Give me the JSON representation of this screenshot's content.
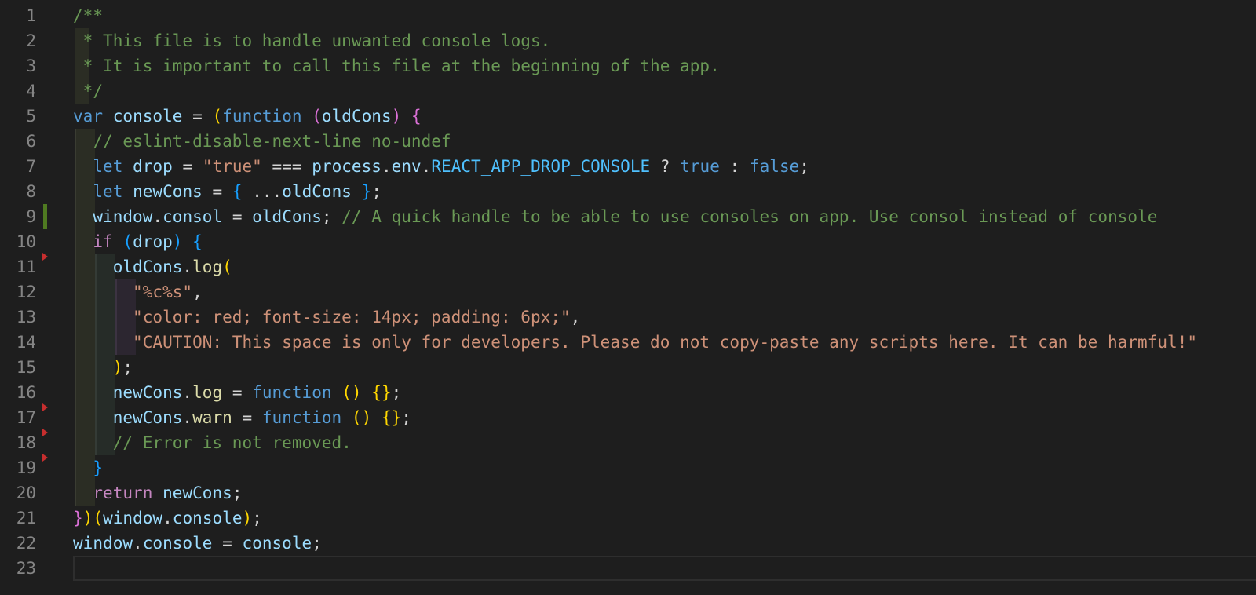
{
  "editor": {
    "language": "javascript",
    "modified_line": 9,
    "fold_markers_at_lines": [
      11,
      17,
      18,
      19
    ],
    "lines": [
      {
        "n": "1",
        "tokens": [
          {
            "t": "/**",
            "c": "cm"
          }
        ]
      },
      {
        "n": "2",
        "tokens": [
          {
            "t": " * This file is to handle unwanted console logs.",
            "c": "cm"
          }
        ]
      },
      {
        "n": "3",
        "tokens": [
          {
            "t": " * It is important to call this file at the beginning of the app.",
            "c": "cm"
          }
        ]
      },
      {
        "n": "4",
        "tokens": [
          {
            "t": " */",
            "c": "cm"
          }
        ]
      },
      {
        "n": "5",
        "tokens": [
          {
            "t": "var",
            "c": "kw"
          },
          {
            "t": " ",
            "c": "pl"
          },
          {
            "t": "console",
            "c": "vr"
          },
          {
            "t": " = ",
            "c": "pl"
          },
          {
            "t": "(",
            "c": "b1"
          },
          {
            "t": "function",
            "c": "kw"
          },
          {
            "t": " ",
            "c": "pl"
          },
          {
            "t": "(",
            "c": "b2"
          },
          {
            "t": "oldCons",
            "c": "vr"
          },
          {
            "t": ")",
            "c": "b2"
          },
          {
            "t": " ",
            "c": "pl"
          },
          {
            "t": "{",
            "c": "b2"
          }
        ]
      },
      {
        "n": "6",
        "tokens": [
          {
            "t": "  ",
            "c": "pl"
          },
          {
            "t": "// eslint-disable-next-line no-undef",
            "c": "cm"
          }
        ]
      },
      {
        "n": "7",
        "tokens": [
          {
            "t": "  ",
            "c": "pl"
          },
          {
            "t": "let",
            "c": "kw"
          },
          {
            "t": " ",
            "c": "pl"
          },
          {
            "t": "drop",
            "c": "vr"
          },
          {
            "t": " = ",
            "c": "pl"
          },
          {
            "t": "\"true\"",
            "c": "st"
          },
          {
            "t": " === ",
            "c": "pl"
          },
          {
            "t": "process",
            "c": "vr"
          },
          {
            "t": ".",
            "c": "pl"
          },
          {
            "t": "env",
            "c": "vr"
          },
          {
            "t": ".",
            "c": "pl"
          },
          {
            "t": "REACT_APP_DROP_CONSOLE",
            "c": "cn"
          },
          {
            "t": " ? ",
            "c": "pl"
          },
          {
            "t": "true",
            "c": "kw"
          },
          {
            "t": " : ",
            "c": "pl"
          },
          {
            "t": "false",
            "c": "kw"
          },
          {
            "t": ";",
            "c": "pl"
          }
        ]
      },
      {
        "n": "8",
        "tokens": [
          {
            "t": "  ",
            "c": "pl"
          },
          {
            "t": "let",
            "c": "kw"
          },
          {
            "t": " ",
            "c": "pl"
          },
          {
            "t": "newCons",
            "c": "vr"
          },
          {
            "t": " = ",
            "c": "pl"
          },
          {
            "t": "{",
            "c": "b3"
          },
          {
            "t": " ...",
            "c": "pl"
          },
          {
            "t": "oldCons",
            "c": "vr"
          },
          {
            "t": " ",
            "c": "pl"
          },
          {
            "t": "}",
            "c": "b3"
          },
          {
            "t": ";",
            "c": "pl"
          }
        ]
      },
      {
        "n": "9",
        "tokens": [
          {
            "t": "  ",
            "c": "pl"
          },
          {
            "t": "window",
            "c": "vr"
          },
          {
            "t": ".",
            "c": "pl"
          },
          {
            "t": "consol",
            "c": "vr"
          },
          {
            "t": " = ",
            "c": "pl"
          },
          {
            "t": "oldCons",
            "c": "vr"
          },
          {
            "t": "; ",
            "c": "pl"
          },
          {
            "t": "// A quick handle to be able to use consoles on app. Use consol instead of console",
            "c": "cm"
          }
        ]
      },
      {
        "n": "10",
        "tokens": [
          {
            "t": "  ",
            "c": "pl"
          },
          {
            "t": "if",
            "c": "ctl"
          },
          {
            "t": " ",
            "c": "pl"
          },
          {
            "t": "(",
            "c": "b3"
          },
          {
            "t": "drop",
            "c": "vr"
          },
          {
            "t": ")",
            "c": "b3"
          },
          {
            "t": " ",
            "c": "pl"
          },
          {
            "t": "{",
            "c": "b3"
          }
        ]
      },
      {
        "n": "11",
        "tokens": [
          {
            "t": "    ",
            "c": "pl"
          },
          {
            "t": "oldCons",
            "c": "vr"
          },
          {
            "t": ".",
            "c": "pl"
          },
          {
            "t": "log",
            "c": "fn"
          },
          {
            "t": "(",
            "c": "b1"
          }
        ]
      },
      {
        "n": "12",
        "tokens": [
          {
            "t": "      ",
            "c": "pl"
          },
          {
            "t": "\"%c%s\"",
            "c": "st"
          },
          {
            "t": ",",
            "c": "pl"
          }
        ]
      },
      {
        "n": "13",
        "tokens": [
          {
            "t": "      ",
            "c": "pl"
          },
          {
            "t": "\"color: red; font-size: 14px; padding: 6px;\"",
            "c": "st"
          },
          {
            "t": ",",
            "c": "pl"
          }
        ]
      },
      {
        "n": "14",
        "tokens": [
          {
            "t": "      ",
            "c": "pl"
          },
          {
            "t": "\"CAUTION: This space is only for developers. Please do not copy-paste any scripts here. It can be harmful!\"",
            "c": "st"
          }
        ]
      },
      {
        "n": "15",
        "tokens": [
          {
            "t": "    ",
            "c": "pl"
          },
          {
            "t": ")",
            "c": "b1"
          },
          {
            "t": ";",
            "c": "pl"
          }
        ]
      },
      {
        "n": "16",
        "tokens": [
          {
            "t": "    ",
            "c": "pl"
          },
          {
            "t": "newCons",
            "c": "vr"
          },
          {
            "t": ".",
            "c": "pl"
          },
          {
            "t": "log",
            "c": "fn"
          },
          {
            "t": " = ",
            "c": "pl"
          },
          {
            "t": "function",
            "c": "kw"
          },
          {
            "t": " ",
            "c": "pl"
          },
          {
            "t": "()",
            "c": "b1"
          },
          {
            "t": " ",
            "c": "pl"
          },
          {
            "t": "{}",
            "c": "b1"
          },
          {
            "t": ";",
            "c": "pl"
          }
        ]
      },
      {
        "n": "17",
        "tokens": [
          {
            "t": "    ",
            "c": "pl"
          },
          {
            "t": "newCons",
            "c": "vr"
          },
          {
            "t": ".",
            "c": "pl"
          },
          {
            "t": "warn",
            "c": "fn"
          },
          {
            "t": " = ",
            "c": "pl"
          },
          {
            "t": "function",
            "c": "kw"
          },
          {
            "t": " ",
            "c": "pl"
          },
          {
            "t": "()",
            "c": "b1"
          },
          {
            "t": " ",
            "c": "pl"
          },
          {
            "t": "{}",
            "c": "b1"
          },
          {
            "t": ";",
            "c": "pl"
          }
        ]
      },
      {
        "n": "18",
        "tokens": [
          {
            "t": "    ",
            "c": "pl"
          },
          {
            "t": "// Error is not removed.",
            "c": "cm"
          }
        ]
      },
      {
        "n": "19",
        "tokens": [
          {
            "t": "  ",
            "c": "pl"
          },
          {
            "t": "}",
            "c": "b3"
          }
        ]
      },
      {
        "n": "20",
        "tokens": [
          {
            "t": "  ",
            "c": "pl"
          },
          {
            "t": "return",
            "c": "ctl"
          },
          {
            "t": " ",
            "c": "pl"
          },
          {
            "t": "newCons",
            "c": "vr"
          },
          {
            "t": ";",
            "c": "pl"
          }
        ]
      },
      {
        "n": "21",
        "tokens": [
          {
            "t": "}",
            "c": "b2"
          },
          {
            "t": ")",
            "c": "b1"
          },
          {
            "t": "(",
            "c": "b1"
          },
          {
            "t": "window",
            "c": "vr"
          },
          {
            "t": ".",
            "c": "pl"
          },
          {
            "t": "console",
            "c": "vr"
          },
          {
            "t": ")",
            "c": "b1"
          },
          {
            "t": ";",
            "c": "pl"
          }
        ]
      },
      {
        "n": "22",
        "tokens": [
          {
            "t": "window",
            "c": "vr"
          },
          {
            "t": ".",
            "c": "pl"
          },
          {
            "t": "console",
            "c": "vr"
          },
          {
            "t": " = ",
            "c": "pl"
          },
          {
            "t": "console",
            "c": "vr"
          },
          {
            "t": ";",
            "c": "pl"
          }
        ]
      },
      {
        "n": "23",
        "tokens": []
      }
    ]
  }
}
